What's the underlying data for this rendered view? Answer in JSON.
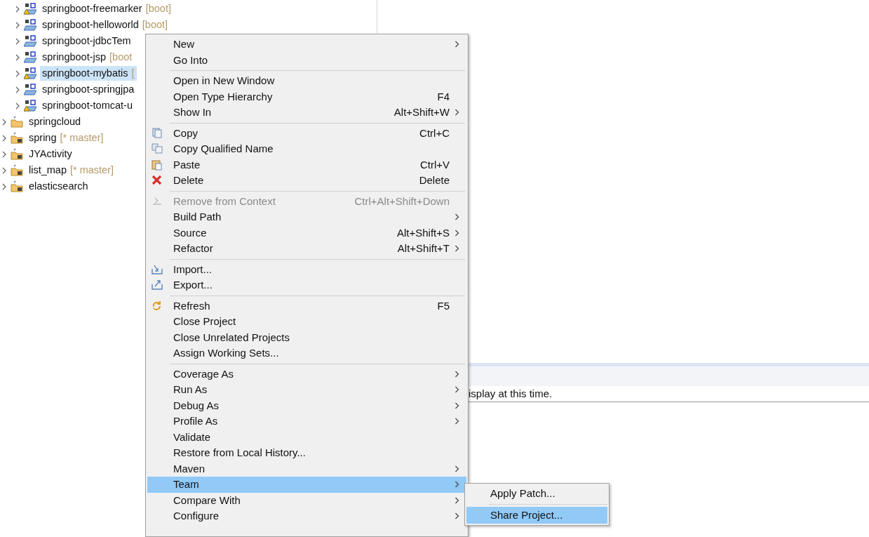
{
  "nested_projects": [
    {
      "label": "springboot-freemarker",
      "decoration": "[boot]",
      "kind": "maven",
      "warning": true,
      "selected": false
    },
    {
      "label": "springboot-helloworld",
      "decoration": "[boot]",
      "kind": "maven",
      "warning": false,
      "selected": false
    },
    {
      "label": "springboot-jdbcTem",
      "kind": "maven",
      "warning": false,
      "selected": false
    },
    {
      "label": "springboot-jsp",
      "decoration": "[boot",
      "kind": "maven",
      "warning": false,
      "selected": false
    },
    {
      "label": "springboot-mybatis",
      "decoration": "[",
      "kind": "maven",
      "warning": true,
      "selected": true
    },
    {
      "label": "springboot-springjpa",
      "kind": "maven",
      "warning": false,
      "selected": false
    },
    {
      "label": "springboot-tomcat-u",
      "kind": "maven",
      "warning": true,
      "selected": false
    }
  ],
  "projects": [
    {
      "label": "springcloud",
      "kind": "folder",
      "warning": false,
      "selected": false
    },
    {
      "label": "spring",
      "decoration": "[* master]",
      "kind": "git",
      "warning": false,
      "selected": false
    },
    {
      "label": "JYActivity",
      "kind": "git",
      "warning": false,
      "selected": false
    },
    {
      "label": "list_map",
      "decoration": "[* master]",
      "kind": "git",
      "warning": false,
      "selected": false
    },
    {
      "label": "elasticsearch",
      "kind": "git",
      "warning": false,
      "selected": false
    }
  ],
  "console": {
    "message": "isplay at this time."
  },
  "context_menu": [
    {
      "kind": "item",
      "label": "New",
      "submenu": true,
      "disabled": false,
      "selected": false
    },
    {
      "kind": "item",
      "label": "Go Into",
      "submenu": false,
      "disabled": false,
      "selected": false
    },
    {
      "kind": "separator"
    },
    {
      "kind": "item",
      "label": "Open in New Window",
      "submenu": false,
      "disabled": false,
      "selected": false
    },
    {
      "kind": "item",
      "label": "Open Type Hierarchy",
      "shortcut": "F4",
      "submenu": false,
      "disabled": false,
      "selected": false
    },
    {
      "kind": "item",
      "label": "Show In",
      "shortcut": "Alt+Shift+W",
      "submenu": true,
      "disabled": false,
      "selected": false
    },
    {
      "kind": "separator"
    },
    {
      "kind": "item",
      "label": "Copy",
      "shortcut": "Ctrl+C",
      "submenu": false,
      "disabled": false,
      "selected": false
    },
    {
      "kind": "item",
      "label": "Copy Qualified Name",
      "submenu": false,
      "disabled": false,
      "selected": false
    },
    {
      "kind": "item",
      "label": "Paste",
      "shortcut": "Ctrl+V",
      "submenu": false,
      "disabled": false,
      "selected": false
    },
    {
      "kind": "item",
      "label": "Delete",
      "shortcut": "Delete",
      "submenu": false,
      "disabled": false,
      "selected": false
    },
    {
      "kind": "separator"
    },
    {
      "kind": "item",
      "label": "Remove from Context",
      "shortcut": "Ctrl+Alt+Shift+Down",
      "submenu": false,
      "disabled": true,
      "selected": false
    },
    {
      "kind": "item",
      "label": "Build Path",
      "submenu": true,
      "disabled": false,
      "selected": false
    },
    {
      "kind": "item",
      "label": "Source",
      "shortcut": "Alt+Shift+S",
      "submenu": true,
      "disabled": false,
      "selected": false
    },
    {
      "kind": "item",
      "label": "Refactor",
      "shortcut": "Alt+Shift+T",
      "submenu": true,
      "disabled": false,
      "selected": false
    },
    {
      "kind": "separator"
    },
    {
      "kind": "item",
      "label": "Import...",
      "submenu": false,
      "disabled": false,
      "selected": false
    },
    {
      "kind": "item",
      "label": "Export...",
      "submenu": false,
      "disabled": false,
      "selected": false
    },
    {
      "kind": "separator"
    },
    {
      "kind": "item",
      "label": "Refresh",
      "shortcut": "F5",
      "submenu": false,
      "disabled": false,
      "selected": false
    },
    {
      "kind": "item",
      "label": "Close Project",
      "submenu": false,
      "disabled": false,
      "selected": false
    },
    {
      "kind": "item",
      "label": "Close Unrelated Projects",
      "submenu": false,
      "disabled": false,
      "selected": false
    },
    {
      "kind": "item",
      "label": "Assign Working Sets...",
      "submenu": false,
      "disabled": false,
      "selected": false
    },
    {
      "kind": "separator"
    },
    {
      "kind": "item",
      "label": "Coverage As",
      "submenu": true,
      "disabled": false,
      "selected": false
    },
    {
      "kind": "item",
      "label": "Run As",
      "submenu": true,
      "disabled": false,
      "selected": false
    },
    {
      "kind": "item",
      "label": "Debug As",
      "submenu": true,
      "disabled": false,
      "selected": false
    },
    {
      "kind": "item",
      "label": "Profile As",
      "submenu": true,
      "disabled": false,
      "selected": false
    },
    {
      "kind": "item",
      "label": "Validate",
      "submenu": false,
      "disabled": false,
      "selected": false
    },
    {
      "kind": "item",
      "label": "Restore from Local History...",
      "submenu": false,
      "disabled": false,
      "selected": false
    },
    {
      "kind": "item",
      "label": "Maven",
      "submenu": true,
      "disabled": false,
      "selected": false
    },
    {
      "kind": "item",
      "label": "Team",
      "submenu": true,
      "disabled": false,
      "selected": true
    },
    {
      "kind": "item",
      "label": "Compare With",
      "submenu": true,
      "disabled": false,
      "selected": false
    },
    {
      "kind": "item",
      "label": "Configure",
      "submenu": true,
      "disabled": false,
      "selected": false
    }
  ],
  "team_submenu": [
    {
      "kind": "item",
      "label": "Apply Patch...",
      "selected": false
    },
    {
      "kind": "separator"
    },
    {
      "kind": "item",
      "label": "Share Project...",
      "selected": true
    }
  ]
}
